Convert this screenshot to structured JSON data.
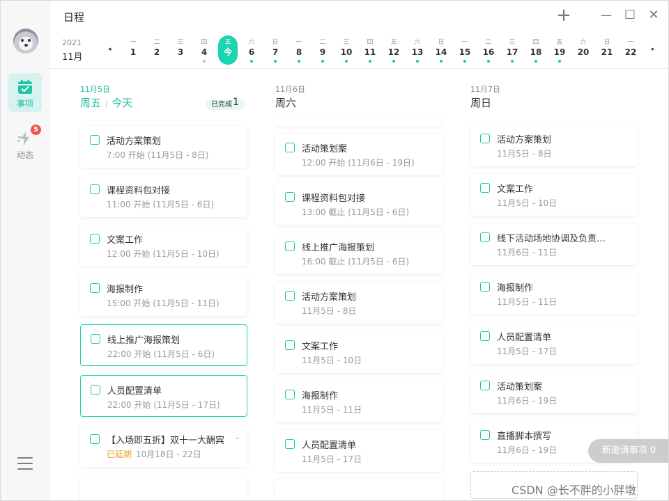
{
  "sidebar": {
    "nav": [
      {
        "label": "事项",
        "icon": "calendar-check-icon"
      },
      {
        "label": "动态",
        "icon": "activity-icon",
        "badge": "5"
      }
    ]
  },
  "header": {
    "title": "日程",
    "add": "+",
    "minimize": "—",
    "maximize": "☐",
    "close": "✕"
  },
  "strip": {
    "year": "2021",
    "month": "11月",
    "prev": "◂",
    "next": "▸",
    "days": [
      {
        "wk": "一",
        "d": "1",
        "dot": ""
      },
      {
        "wk": "二",
        "d": "2",
        "dot": ""
      },
      {
        "wk": "三",
        "d": "3",
        "dot": ""
      },
      {
        "wk": "四",
        "d": "4",
        "dot": "#bbbbbb"
      },
      {
        "wk": "五",
        "d": "今",
        "dot": "",
        "today": true
      },
      {
        "wk": "六",
        "d": "6",
        "dot": "#1bc7a6"
      },
      {
        "wk": "日",
        "d": "7",
        "dot": "#1bc7a6"
      },
      {
        "wk": "一",
        "d": "8",
        "dot": "#1bc7a6"
      },
      {
        "wk": "二",
        "d": "9",
        "dot": "#1bc7a6"
      },
      {
        "wk": "三",
        "d": "10",
        "dot": "#1bc7a6"
      },
      {
        "wk": "四",
        "d": "11",
        "dot": "#1bc7a6"
      },
      {
        "wk": "五",
        "d": "12",
        "dot": "#1bc7a6"
      },
      {
        "wk": "六",
        "d": "13",
        "dot": "#1bc7a6"
      },
      {
        "wk": "日",
        "d": "14",
        "dot": "#1bc7a6"
      },
      {
        "wk": "一",
        "d": "15",
        "dot": "#1bc7a6"
      },
      {
        "wk": "二",
        "d": "16",
        "dot": "#1bc7a6"
      },
      {
        "wk": "三",
        "d": "17",
        "dot": "#1bc7a6"
      },
      {
        "wk": "四",
        "d": "18",
        "dot": "#1bc7a6"
      },
      {
        "wk": "五",
        "d": "19",
        "dot": "#1bc7a6"
      },
      {
        "wk": "六",
        "d": "20",
        "dot": ""
      },
      {
        "wk": "日",
        "d": "21",
        "dot": ""
      },
      {
        "wk": "一",
        "d": "22",
        "dot": ""
      }
    ]
  },
  "columns": [
    {
      "date": "11月5日",
      "day": "周五",
      "today_label": "今天",
      "done_label": "已完成",
      "done_count": "1",
      "cards": [
        {
          "title": "活动方案策划",
          "sub": "7:00 开始 (11月5日 - 8日)"
        },
        {
          "title": "课程资料包对接",
          "sub": "11:00 开始 (11月5日 - 6日)"
        },
        {
          "title": "文案工作",
          "sub": "12:00 开始 (11月5日 - 10日)"
        },
        {
          "title": "海报制作",
          "sub": "15:00 开始 (11月5日 - 11日)"
        },
        {
          "title": "线上推广海报策划",
          "sub": "22:00 开始 (11月5日 - 6日)",
          "selected": true
        },
        {
          "title": "人员配置清单",
          "sub": "22:00 开始 (11月5日 - 17日)",
          "selected": true
        },
        {
          "title": "【入场即五折】双十一大酬宾",
          "late": "已延期",
          "sub": "10月18日 - 22日"
        }
      ]
    },
    {
      "date": "11月6日",
      "day": "周六",
      "cards": [
        {
          "title": "活动策划案",
          "sub": "12:00 开始 (11月6日 - 19日)"
        },
        {
          "title": "课程资料包对接",
          "sub": "13:00 截止 (11月5日 - 6日)"
        },
        {
          "title": "线上推广海报策划",
          "sub": "16:00 截止 (11月5日 - 6日)"
        },
        {
          "title": "活动方案策划",
          "sub": "11月5日 - 8日"
        },
        {
          "title": "文案工作",
          "sub": "11月5日 - 10日"
        },
        {
          "title": "海报制作",
          "sub": "11月5日 - 11日"
        },
        {
          "title": "人员配置清单",
          "sub": "11月5日 - 17日"
        }
      ]
    },
    {
      "date": "11月7日",
      "day": "周日",
      "cards": [
        {
          "title": "活动方案策划",
          "sub": "11月5日 - 8日"
        },
        {
          "title": "文案工作",
          "sub": "11月5日 - 10日"
        },
        {
          "title": "线下活动场地协调及负责…",
          "sub": "11月6日 - 11日"
        },
        {
          "title": "海报制作",
          "sub": "11月5日 - 11日"
        },
        {
          "title": "人员配置清单",
          "sub": "11月5日 - 17日"
        },
        {
          "title": "活动策划案",
          "sub": "11月6日 - 19日"
        },
        {
          "title": "直播脚本撰写",
          "sub": "11月6日 - 19日"
        }
      ]
    }
  ],
  "invite": {
    "label": "新邀请事项 0"
  },
  "watermark": "CSDN @长不胖的小胖墩",
  "colors": {
    "accent": "#1bd4b0",
    "late": "#f0a132",
    "badge": "#f4514e"
  }
}
